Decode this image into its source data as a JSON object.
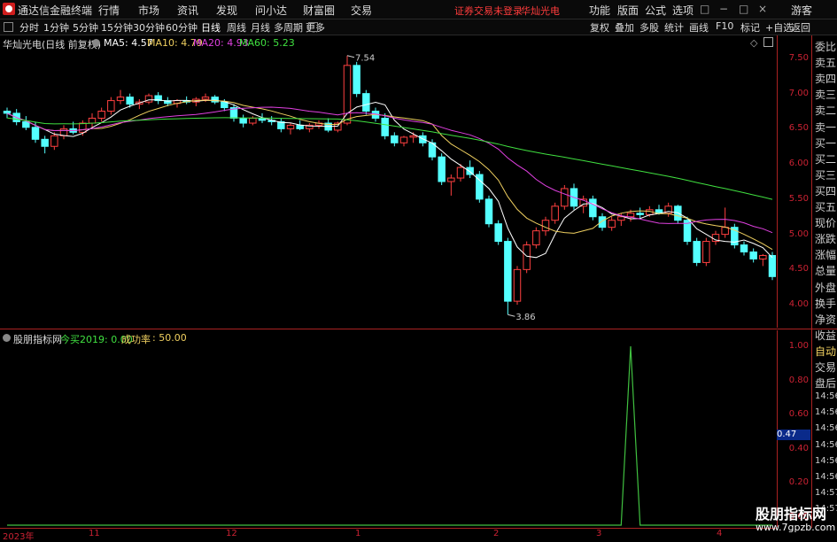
{
  "app": {
    "title": "通达信金融终端",
    "menus": [
      "行情",
      "市场",
      "资讯",
      "发现",
      "问小达",
      "财富圈",
      "交易"
    ],
    "login_status": "证券交易未登录",
    "stock_name": "华灿光电",
    "right_menus": [
      "功能",
      "版面",
      "公式",
      "选项"
    ],
    "user": "游客",
    "window_controls": [
      "□",
      "−",
      "□",
      "×"
    ]
  },
  "toolbar": {
    "periods": [
      "分时",
      "1分钟",
      "5分钟",
      "15分钟",
      "30分钟",
      "60分钟",
      "日线",
      "周线",
      "月线",
      "多周期",
      "更多"
    ],
    "active_period": "日线",
    "right_buttons": [
      "复权",
      "叠加",
      "多股",
      "统计",
      "画线",
      "F10",
      "标记",
      "+自选",
      "返回"
    ]
  },
  "main_chart": {
    "header_name": "华灿光电(日线 前复权)",
    "ma_labels": [
      {
        "label": "MA5: 4.57",
        "color": "#ffffff"
      },
      {
        "label": "MA10: 4.79",
        "color": "#f0d060"
      },
      {
        "label": "MA20: 4.93",
        "color": "#e040e0"
      },
      {
        "label": "MA60: 5.23",
        "color": "#40e040"
      }
    ],
    "y_ticks": [
      "7.50",
      "7.00",
      "6.50",
      "6.00",
      "5.50",
      "5.00",
      "4.50",
      "4.00"
    ],
    "y_range": [
      3.8,
      7.7
    ],
    "high_marker": "7.54",
    "low_marker": "3.86",
    "up_color": "#ff4040",
    "down_color": "#54ffff"
  },
  "indicator": {
    "name": "股朋指标网",
    "item1": "今买2019: 0.00",
    "item2_label": "成功率",
    "item2_value": ": 50.00",
    "y_ticks": [
      "1.00",
      "0.80",
      "0.60",
      "0.40",
      "0.20",
      "0.00"
    ],
    "current_value": "0.47",
    "line_color": "#40c040"
  },
  "x_axis": [
    "2023年",
    "11",
    "12",
    "1",
    "2",
    "3",
    "4"
  ],
  "right_panel": [
    "委比",
    "卖五",
    "卖四",
    "卖三",
    "卖二",
    "卖一",
    "买一",
    "买二",
    "买三",
    "买四",
    "买五",
    "现价",
    "涨跌",
    "涨幅",
    "总量",
    "外盘",
    "换手",
    "净资",
    "收益",
    "自动",
    "交易",
    "盘后",
    "14:56",
    "14:56",
    "14:56",
    "14:56",
    "14:56",
    "14:56",
    "14:57",
    "14:57"
  ],
  "watermark": {
    "line1": "股朋指标网",
    "line2": "www.7gpzb.com"
  },
  "chart_data": {
    "type": "candlestick",
    "candles": [
      [
        6.75,
        6.8,
        6.65,
        6.72
      ],
      [
        6.72,
        6.78,
        6.55,
        6.6
      ],
      [
        6.6,
        6.68,
        6.48,
        6.52
      ],
      [
        6.52,
        6.6,
        6.3,
        6.35
      ],
      [
        6.35,
        6.4,
        6.15,
        6.25
      ],
      [
        6.25,
        6.45,
        6.2,
        6.4
      ],
      [
        6.4,
        6.55,
        6.35,
        6.5
      ],
      [
        6.5,
        6.6,
        6.42,
        6.45
      ],
      [
        6.45,
        6.62,
        6.4,
        6.58
      ],
      [
        6.58,
        6.72,
        6.52,
        6.65
      ],
      [
        6.65,
        6.8,
        6.6,
        6.75
      ],
      [
        6.75,
        6.95,
        6.7,
        6.9
      ],
      [
        6.9,
        7.05,
        6.85,
        6.95
      ],
      [
        6.95,
        7.0,
        6.8,
        6.85
      ],
      [
        6.85,
        6.92,
        6.78,
        6.88
      ],
      [
        6.88,
        7.0,
        6.85,
        6.97
      ],
      [
        6.97,
        7.02,
        6.85,
        6.9
      ],
      [
        6.9,
        6.95,
        6.82,
        6.86
      ],
      [
        6.86,
        6.92,
        6.8,
        6.9
      ],
      [
        6.9,
        6.96,
        6.85,
        6.88
      ],
      [
        6.88,
        6.95,
        6.82,
        6.92
      ],
      [
        6.92,
        7.0,
        6.88,
        6.95
      ],
      [
        6.95,
        6.98,
        6.85,
        6.88
      ],
      [
        6.88,
        6.92,
        6.75,
        6.8
      ],
      [
        6.8,
        6.85,
        6.6,
        6.65
      ],
      [
        6.65,
        6.7,
        6.52,
        6.58
      ],
      [
        6.58,
        6.68,
        6.55,
        6.65
      ],
      [
        6.65,
        6.72,
        6.58,
        6.62
      ],
      [
        6.62,
        6.68,
        6.55,
        6.6
      ],
      [
        6.6,
        6.65,
        6.45,
        6.5
      ],
      [
        6.5,
        6.58,
        6.42,
        6.55
      ],
      [
        6.55,
        6.62,
        6.48,
        6.5
      ],
      [
        6.5,
        6.58,
        6.45,
        6.55
      ],
      [
        6.55,
        6.62,
        6.5,
        6.58
      ],
      [
        6.58,
        6.65,
        6.45,
        6.48
      ],
      [
        6.48,
        6.6,
        6.45,
        6.58
      ],
      [
        6.58,
        7.54,
        6.55,
        7.4
      ],
      [
        7.4,
        7.45,
        6.95,
        7.0
      ],
      [
        7.0,
        7.05,
        6.7,
        6.75
      ],
      [
        6.75,
        6.8,
        6.6,
        6.65
      ],
      [
        6.65,
        6.72,
        6.35,
        6.4
      ],
      [
        6.4,
        6.45,
        6.25,
        6.3
      ],
      [
        6.3,
        6.4,
        6.25,
        6.38
      ],
      [
        6.38,
        6.45,
        6.3,
        6.4
      ],
      [
        6.4,
        6.45,
        6.25,
        6.3
      ],
      [
        6.3,
        6.35,
        6.05,
        6.1
      ],
      [
        6.1,
        6.15,
        5.7,
        5.75
      ],
      [
        5.75,
        5.85,
        5.55,
        5.8
      ],
      [
        5.8,
        6.0,
        5.75,
        5.95
      ],
      [
        5.95,
        6.05,
        5.8,
        5.85
      ],
      [
        5.85,
        5.9,
        5.45,
        5.5
      ],
      [
        5.5,
        5.55,
        5.1,
        5.15
      ],
      [
        5.15,
        5.2,
        4.85,
        4.9
      ],
      [
        4.9,
        4.95,
        3.86,
        4.05
      ],
      [
        4.05,
        4.55,
        4.0,
        4.5
      ],
      [
        4.5,
        4.9,
        4.45,
        4.85
      ],
      [
        4.85,
        5.1,
        4.8,
        5.05
      ],
      [
        5.05,
        5.25,
        4.98,
        5.2
      ],
      [
        5.2,
        5.45,
        5.15,
        5.4
      ],
      [
        5.4,
        5.7,
        5.35,
        5.65
      ],
      [
        5.65,
        5.72,
        5.35,
        5.4
      ],
      [
        5.4,
        5.55,
        5.3,
        5.5
      ],
      [
        5.5,
        5.55,
        5.2,
        5.25
      ],
      [
        5.25,
        5.3,
        5.05,
        5.1
      ],
      [
        5.1,
        5.25,
        5.05,
        5.2
      ],
      [
        5.2,
        5.3,
        5.12,
        5.25
      ],
      [
        5.25,
        5.35,
        5.18,
        5.3
      ],
      [
        5.3,
        5.38,
        5.22,
        5.28
      ],
      [
        5.28,
        5.4,
        5.25,
        5.35
      ],
      [
        5.35,
        5.42,
        5.28,
        5.3
      ],
      [
        5.3,
        5.45,
        5.25,
        5.4
      ],
      [
        5.4,
        5.42,
        5.15,
        5.2
      ],
      [
        5.2,
        5.25,
        4.85,
        4.9
      ],
      [
        4.9,
        4.95,
        4.55,
        4.6
      ],
      [
        4.6,
        4.95,
        4.55,
        4.9
      ],
      [
        4.9,
        5.05,
        4.85,
        5.0
      ],
      [
        5.0,
        5.38,
        4.95,
        5.1
      ],
      [
        5.1,
        5.15,
        4.8,
        4.85
      ],
      [
        4.85,
        4.9,
        4.7,
        4.75
      ],
      [
        4.75,
        4.8,
        4.6,
        4.65
      ],
      [
        4.65,
        4.72,
        4.55,
        4.7
      ],
      [
        4.7,
        4.75,
        4.35,
        4.4
      ]
    ],
    "ma": [
      {
        "name": "MA5",
        "color": "#ffffff"
      },
      {
        "name": "MA10",
        "color": "#f0d060"
      },
      {
        "name": "MA20",
        "color": "#e040e0"
      },
      {
        "name": "MA60",
        "color": "#40e040"
      }
    ],
    "indicator_series": {
      "values_peak_index": 66,
      "range": [
        0,
        1
      ]
    }
  }
}
